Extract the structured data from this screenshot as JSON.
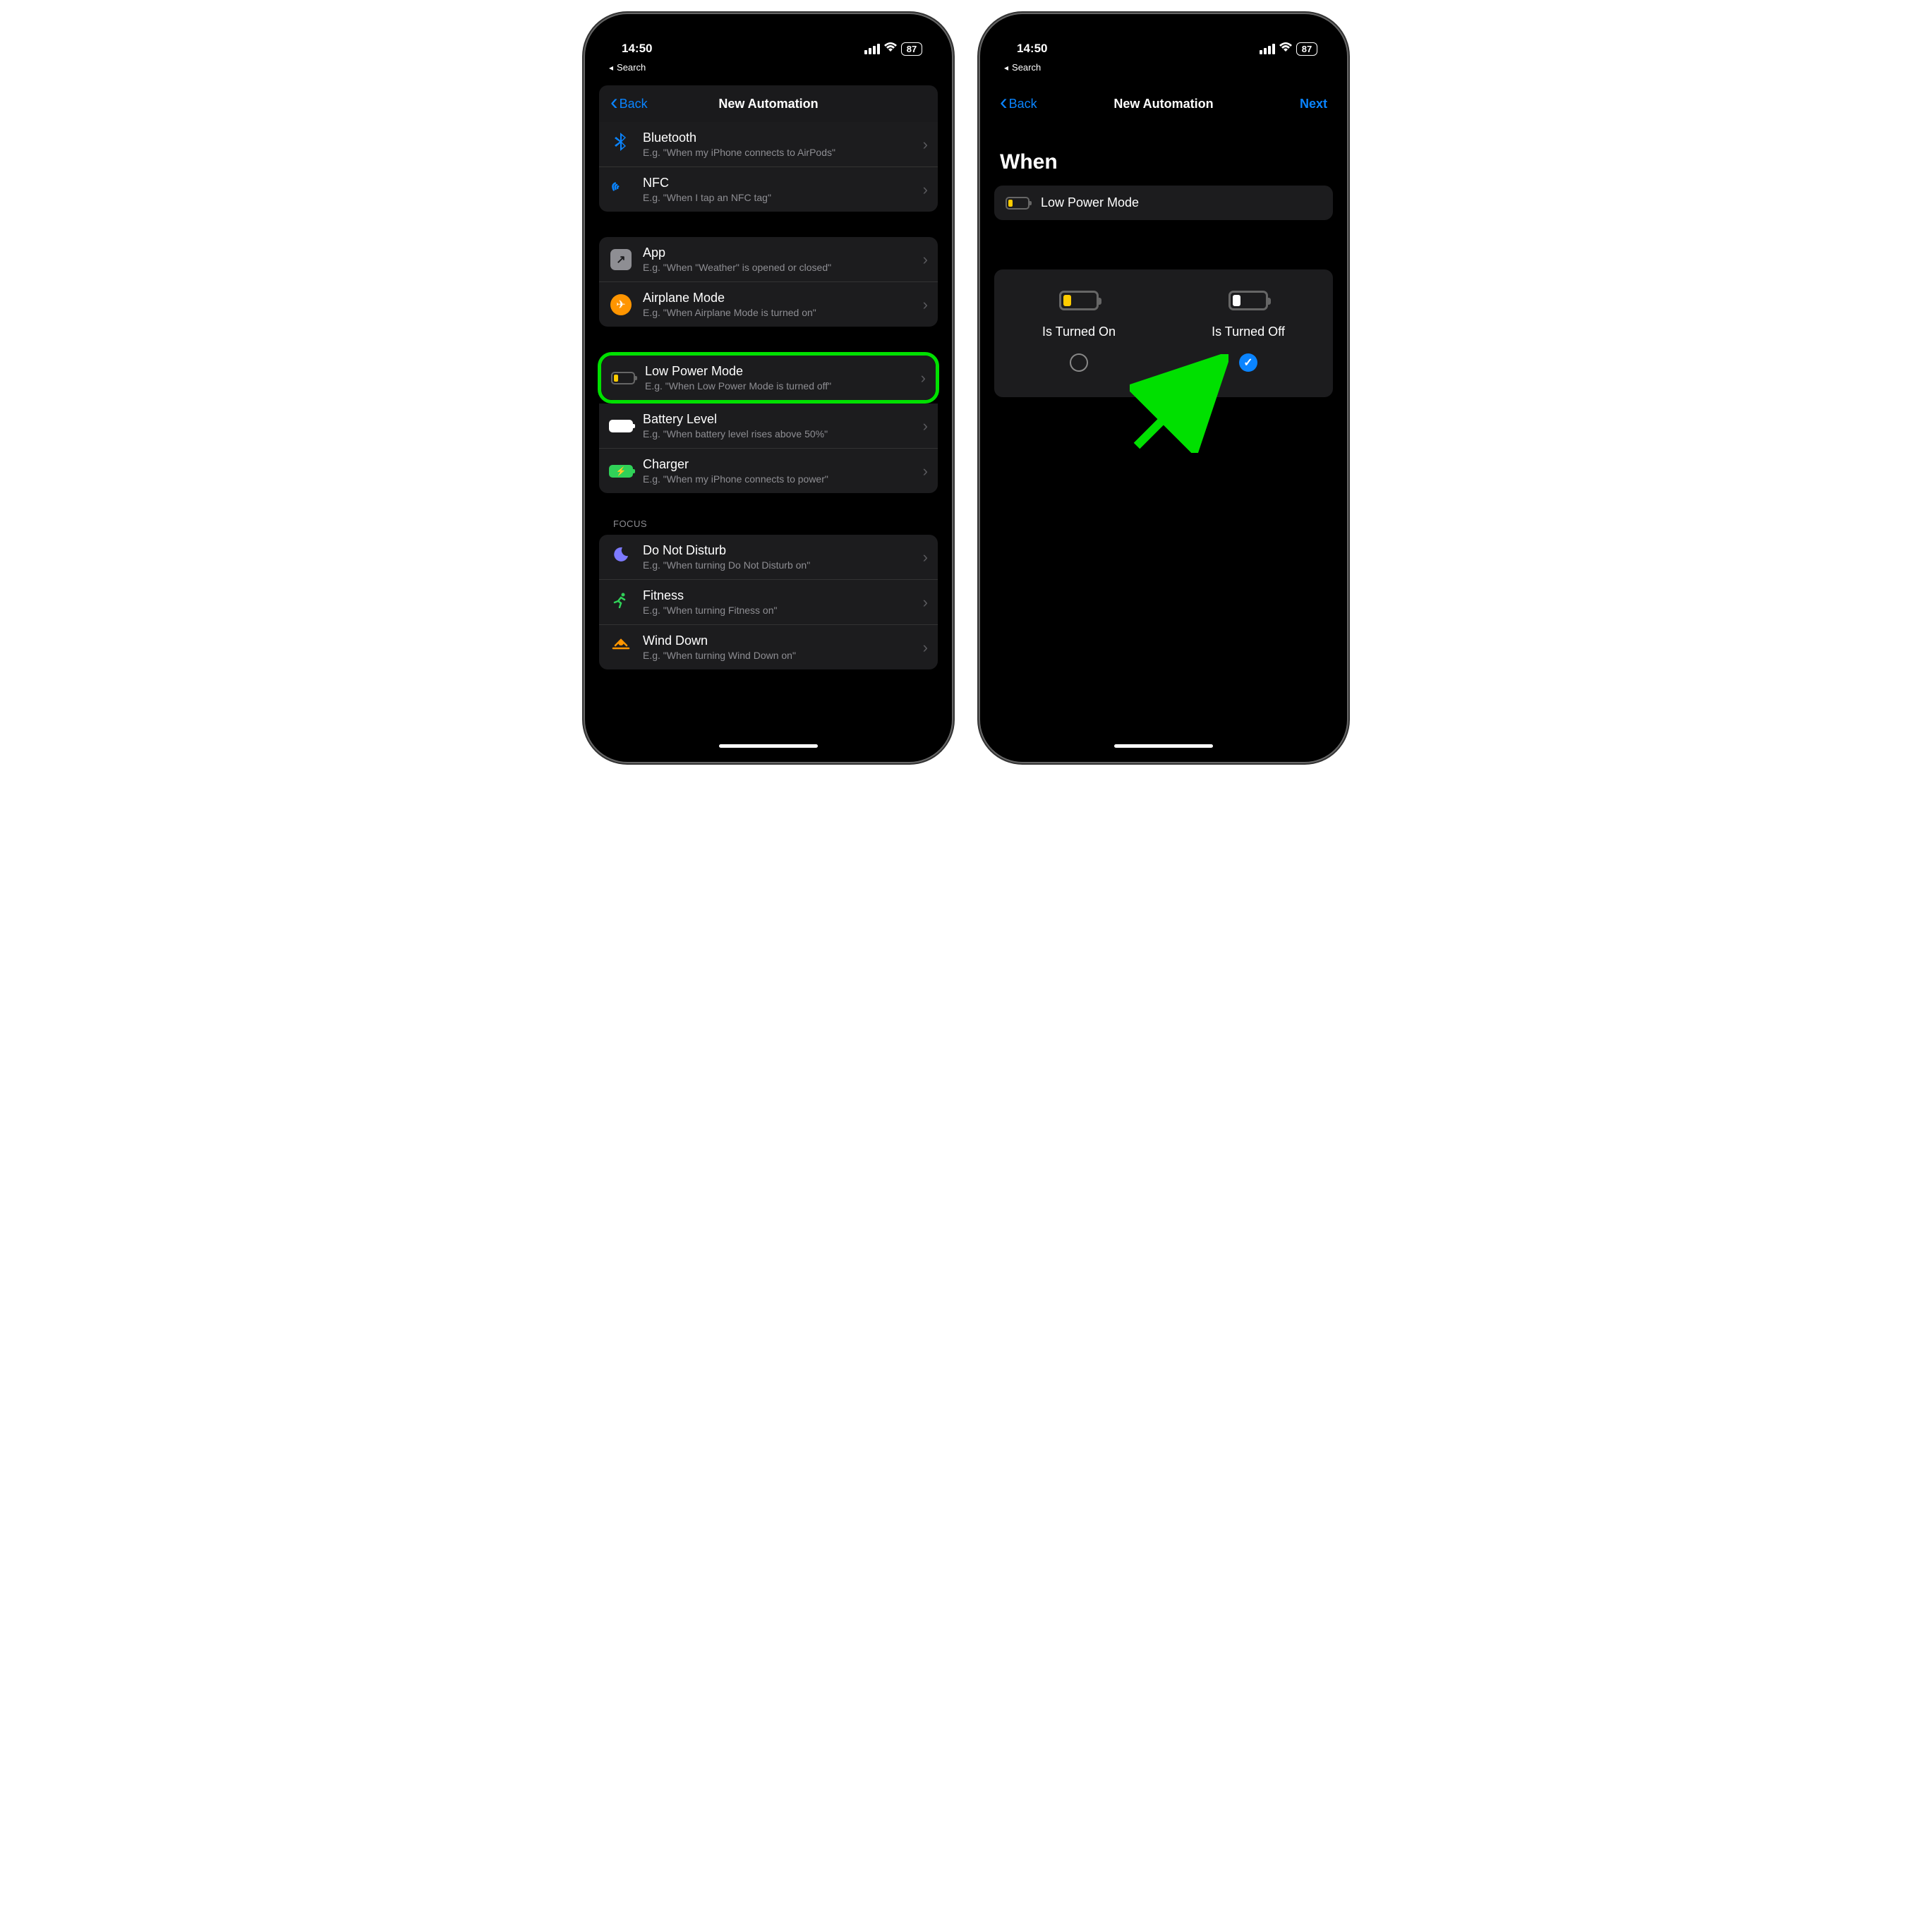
{
  "status": {
    "time": "14:50",
    "battery": "87",
    "breadcrumb": "Search"
  },
  "screen1": {
    "nav": {
      "back": "Back",
      "title": "New Automation"
    },
    "g1": {
      "bluetooth": {
        "title": "Bluetooth",
        "sub": "E.g. \"When my iPhone connects to AirPods\""
      },
      "nfc": {
        "title": "NFC",
        "sub": "E.g. \"When I tap an NFC tag\""
      }
    },
    "g2": {
      "app": {
        "title": "App",
        "sub": "E.g. \"When \"Weather\" is opened or closed\""
      },
      "airplane": {
        "title": "Airplane Mode",
        "sub": "E.g. \"When Airplane Mode is turned on\""
      }
    },
    "lpm": {
      "title": "Low Power Mode",
      "sub": "E.g. \"When Low Power Mode is turned off\""
    },
    "g3": {
      "battlevel": {
        "title": "Battery Level",
        "sub": "E.g. \"When battery level rises above 50%\""
      },
      "charger": {
        "title": "Charger",
        "sub": "E.g. \"When my iPhone connects to power\""
      }
    },
    "focus_header": "Focus",
    "g4": {
      "dnd": {
        "title": "Do Not Disturb",
        "sub": "E.g. \"When turning Do Not Disturb on\""
      },
      "fitness": {
        "title": "Fitness",
        "sub": "E.g. \"When turning Fitness on\""
      },
      "winddown": {
        "title": "Wind Down",
        "sub": "E.g. \"When turning Wind Down on\""
      }
    }
  },
  "screen2": {
    "nav": {
      "back": "Back",
      "title": "New Automation",
      "next": "Next"
    },
    "when_heading": "When",
    "trigger_title": "Low Power Mode",
    "choice_on": "Is Turned On",
    "choice_off": "Is Turned Off"
  }
}
